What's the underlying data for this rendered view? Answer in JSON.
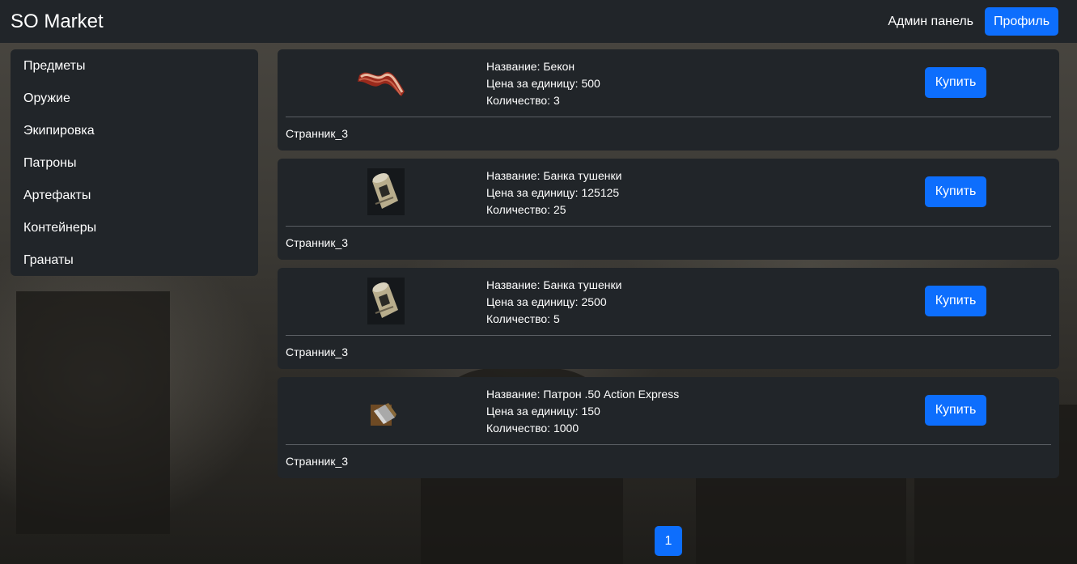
{
  "navbar": {
    "brand": "SO Market",
    "admin_link": "Админ панель",
    "profile_button": "Профиль"
  },
  "sidebar": {
    "items": [
      {
        "label": "Предметы"
      },
      {
        "label": "Оружие"
      },
      {
        "label": "Экипировка"
      },
      {
        "label": "Патроны"
      },
      {
        "label": "Артефакты"
      },
      {
        "label": "Контейнеры"
      },
      {
        "label": "Гранаты"
      }
    ]
  },
  "listings": [
    {
      "name_line": "Название: Бекон",
      "price_line": "Цена за единицу: 500",
      "qty_line": "Количество: 3",
      "buy_label": "Купить",
      "seller": "Странник_3",
      "icon": "bacon-icon"
    },
    {
      "name_line": "Название: Банка тушенки",
      "price_line": "Цена за единицу: 125125",
      "qty_line": "Количество: 25",
      "buy_label": "Купить",
      "seller": "Странник_3",
      "icon": "canned-meat-icon"
    },
    {
      "name_line": "Название: Банка тушенки",
      "price_line": "Цена за единицу: 2500",
      "qty_line": "Количество: 5",
      "buy_label": "Купить",
      "seller": "Странник_3",
      "icon": "canned-meat-icon"
    },
    {
      "name_line": "Название: Патрон .50 Action Express",
      "price_line": "Цена за единицу: 150",
      "qty_line": "Количество: 1000",
      "buy_label": "Купить",
      "seller": "Странник_3",
      "icon": "ammo-icon"
    }
  ],
  "pagination": {
    "current_page": "1"
  },
  "colors": {
    "accent": "#0d6efd",
    "panel": "#212529"
  }
}
